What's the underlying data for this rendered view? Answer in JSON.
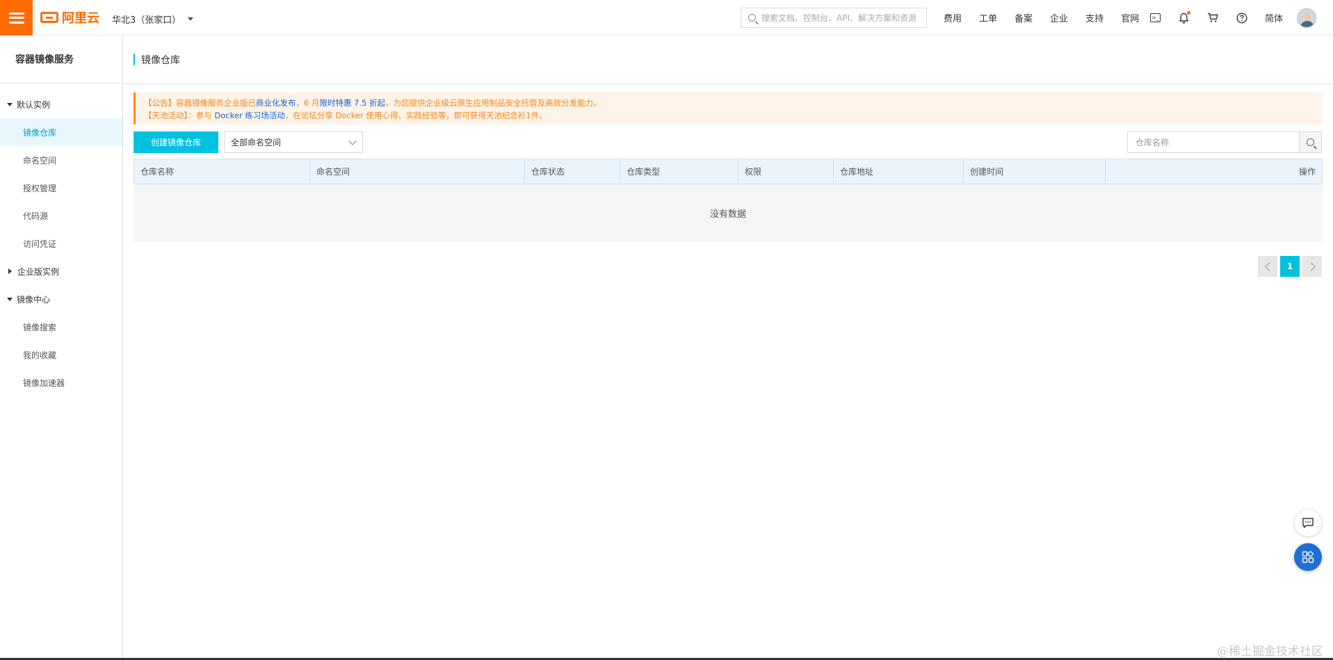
{
  "topbar": {
    "logo_text": "阿里云",
    "region": "华北3（张家口）",
    "search_placeholder": "搜索文档、控制台、API、解决方案和资源",
    "links": [
      "费用",
      "工单",
      "备案",
      "企业",
      "支持",
      "官网"
    ],
    "lang": "简体",
    "icons": [
      "terminal-icon",
      "bell-icon",
      "cart-icon",
      "help-icon"
    ],
    "accent_color": "#ff6a00"
  },
  "sidebar": {
    "title": "容器镜像服务",
    "groups": [
      {
        "label": "默认实例",
        "expanded": true,
        "items": [
          "镜像仓库",
          "命名空间",
          "授权管理",
          "代码源",
          "访问凭证"
        ]
      },
      {
        "label": "企业版实例",
        "expanded": false,
        "items": []
      },
      {
        "label": "镜像中心",
        "expanded": true,
        "items": [
          "镜像搜索",
          "我的收藏",
          "镜像加速器"
        ]
      }
    ],
    "active_item": "镜像仓库"
  },
  "main": {
    "title": "镜像仓库",
    "notice": {
      "line1": {
        "a": "【公告】容器镜像服务企业版已",
        "b": "商业化发布",
        "c": "，6 月",
        "d": "限时特惠 7.5 折起",
        "e": "，为您提供企业级云原生应用制品安全托管及高效分发能力。"
      },
      "line2": {
        "a": "【天池活动】：参与 ",
        "b": "Docker 练习场活动",
        "c": "，在论坛分享 Docker 使用心得、实践经验等，即可获得天池纪念衫1件。"
      }
    },
    "create_button": "创建镜像仓库",
    "namespace_select": "全部命名空间",
    "repo_search_placeholder": "仓库名称",
    "table": {
      "columns": [
        "仓库名称",
        "命名空间",
        "仓库状态",
        "仓库类型",
        "权限",
        "仓库地址",
        "创建时间",
        "操作"
      ],
      "empty_text": "没有数据"
    },
    "pagination": {
      "current": "1"
    }
  },
  "watermark": "@稀土掘金技术社区",
  "colors": {
    "primary": "#00c1de",
    "notice_bg": "#fdf3e8",
    "notice_text": "#f08519",
    "link_blue": "#1a63c8"
  }
}
